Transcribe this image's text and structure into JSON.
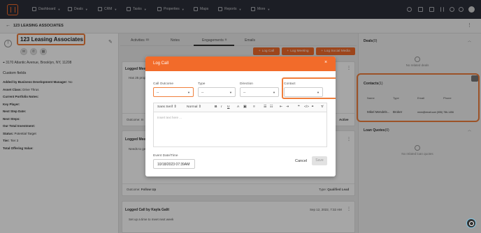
{
  "nav": {
    "items": [
      {
        "label": "Dashboard",
        "icon": "home-icon"
      },
      {
        "label": "Deals",
        "icon": "deals-icon"
      },
      {
        "label": "CRM",
        "icon": "crm-icon"
      },
      {
        "label": "Tasks",
        "icon": "tasks-icon"
      },
      {
        "label": "Properties",
        "icon": "properties-icon"
      },
      {
        "label": "Maps",
        "icon": "maps-icon"
      },
      {
        "label": "Reports",
        "icon": "reports-icon"
      },
      {
        "label": "More",
        "icon": "more-icon"
      }
    ]
  },
  "breadcrumb": {
    "back": "←",
    "title": "123 LEASING ASSOCIATES"
  },
  "company": {
    "name": "123 Leasing Associates",
    "address": "3170 Atlantic Avenue, Brooklyn, NY, 11208",
    "custom_fields_label": "Custom fields",
    "fields": [
      {
        "label": "Added by Business Development Manager:",
        "value": "No"
      },
      {
        "label": "Asset Class:",
        "value": "Drive Thrus"
      },
      {
        "label": "Current Portfolio Notes:",
        "value": ""
      },
      {
        "label": "Key Player:",
        "value": ""
      },
      {
        "label": "Next Step Date:",
        "value": ""
      },
      {
        "label": "Next Steps:",
        "value": ""
      },
      {
        "label": "Our Total Investment:",
        "value": ""
      },
      {
        "label": "Status:",
        "value": "Potential Target"
      },
      {
        "label": "Tier:",
        "value": "Tier 3"
      },
      {
        "label": "Total Offering Value:",
        "value": ""
      }
    ]
  },
  "tabs": [
    {
      "label": "Activities",
      "badge": "15"
    },
    {
      "label": "Notes",
      "badge": ""
    },
    {
      "label": "Engagements",
      "badge": "9"
    },
    {
      "label": "Emails",
      "badge": ""
    }
  ],
  "actions": {
    "log_call": "Log Call",
    "log_meeting": "Log Meeting",
    "log_social": "Log Social Media"
  },
  "cards": {
    "c1_title": "Logged Meet",
    "c1_text": "Has 25 prope",
    "c1_outcome_label": "Outcome:",
    "c1_outcome": "In",
    "c1_status": "Active",
    "c2_title": "Logged Meet",
    "c2_text": "Needs to get",
    "c2_outcome_label": "Outcome:",
    "c2_outcome": "Follow Up",
    "c2_type_label": "Type:",
    "c2_type": "Qualified Lead",
    "c3_title": "Logged Call by Kayla Galit",
    "c3_date": "Sep 12, 2022, 7:32 AM",
    "c3_text": "Set up a time to meet next week"
  },
  "right": {
    "deals_title": "Deals",
    "deals_count": "(0)",
    "deals_empty": "No related deals",
    "contacts_title": "Contacts",
    "contacts_count": "(1)",
    "cols": {
      "name": "Name",
      "type": "Type",
      "email": "Email",
      "phone": "Phone"
    },
    "contact": {
      "name": "Mikel Mendels...",
      "type": "Broker",
      "email": "mnm@email.com",
      "phone": "(555) 786-1456"
    },
    "loan_title": "Loan Quotes",
    "loan_count": "(0)",
    "loan_empty": "No related loan quotes"
  },
  "modal": {
    "title": "Log Call",
    "close": "×",
    "call_outcome_label": "Call Outcome",
    "call_outcome_value": "--",
    "type_label": "Type",
    "type_value": "--",
    "direction_label": "Direction",
    "direction_value": "--",
    "contact_label": "Contact",
    "contact_value": "",
    "font_value": "Sans Serif",
    "size_value": "Normal",
    "editor_placeholder": "Insert text here ...",
    "date_label": "Event Date/Time",
    "date_value": "10/18/2023  07:39AM",
    "cancel": "Cancel",
    "save": "Save"
  },
  "colors": {
    "accent": "#f26b2a",
    "highlight": "#f07f3c",
    "nav_bg": "#2c2f3a"
  }
}
